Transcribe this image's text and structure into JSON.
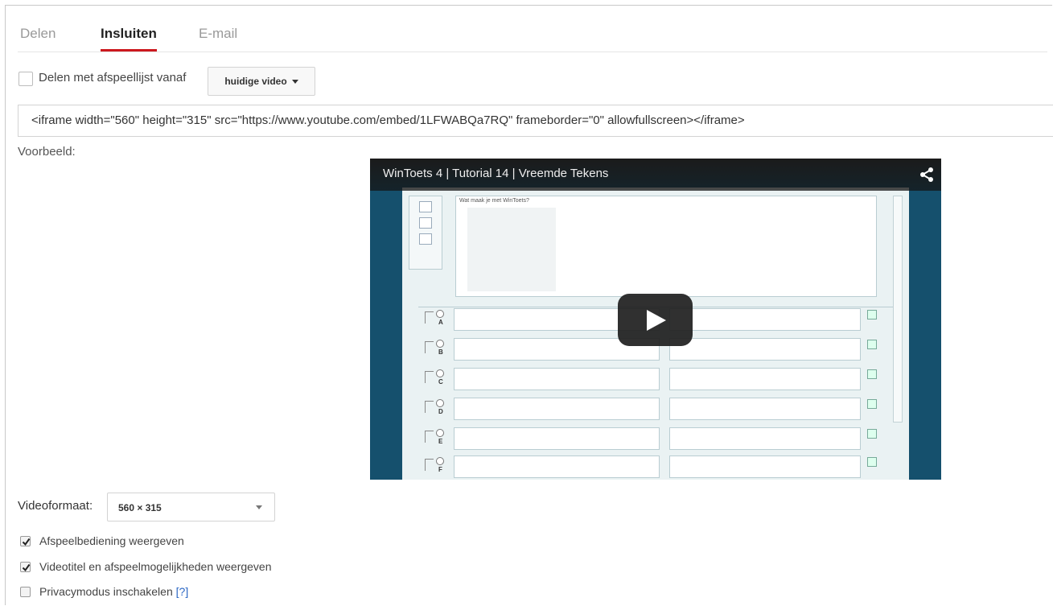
{
  "tabs": [
    {
      "label": "Delen",
      "active": false
    },
    {
      "label": "Insluiten",
      "active": true
    },
    {
      "label": "E-mail",
      "active": false
    }
  ],
  "playlist": {
    "label": "Delen met afspeellijst vanaf",
    "checked": false,
    "dropdown_value": "huidige video"
  },
  "embed_code": "<iframe width=\"560\" height=\"315\" src=\"https://www.youtube.com/embed/1LFWABQa7RQ\" frameborder=\"0\" allowfullscreen></iframe>",
  "preview": {
    "label": "Voorbeeld:",
    "video_title": "WinToets 4 | Tutorial 14 | Vreemde Tekens",
    "screen_placeholder": "Wat maak je met WinToets?",
    "answer_letters": [
      "A",
      "B",
      "C",
      "D",
      "E",
      "F"
    ]
  },
  "video_size": {
    "label": "Videoformaat:",
    "value": "560 × 315"
  },
  "options": [
    {
      "label": "Afspeelbediening weergeven",
      "checked": true
    },
    {
      "label": "Videotitel en afspeelmogelijkheden weergeven",
      "checked": true
    },
    {
      "label": "Privacymodus inschakelen",
      "checked": false,
      "help": "[?]"
    }
  ],
  "colors": {
    "accent": "#cc181e",
    "link": "#2a66c4",
    "video_bg": "#15506d"
  }
}
